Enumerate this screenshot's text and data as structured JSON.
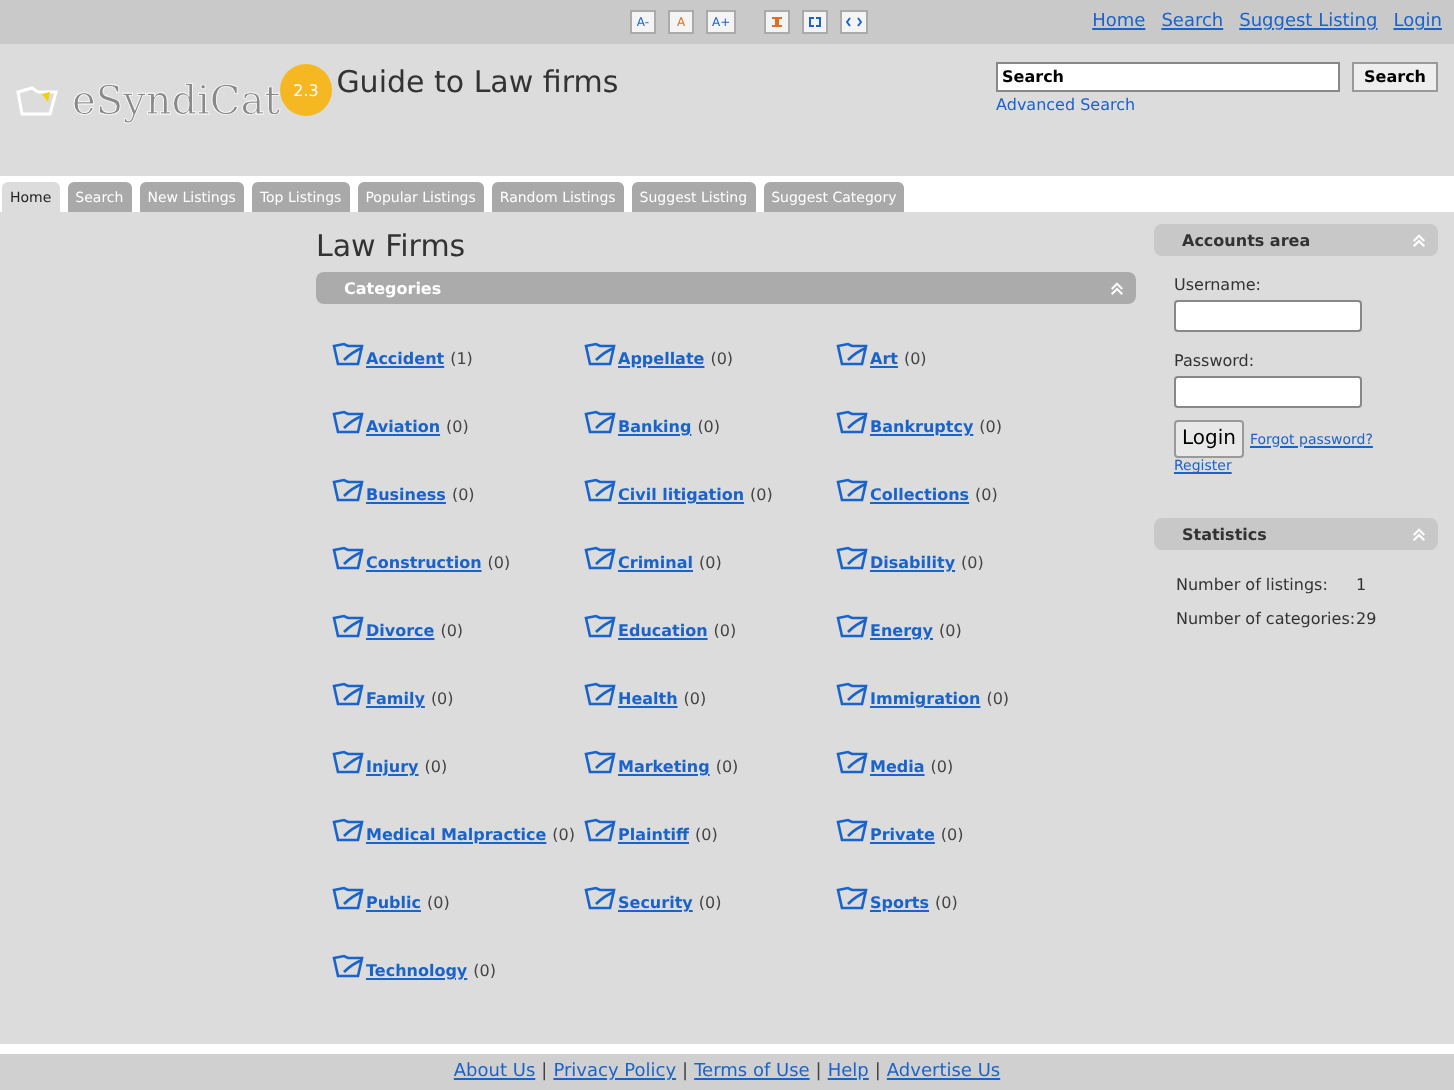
{
  "font_tools": [
    "A-",
    "A",
    "A+"
  ],
  "top_links": [
    "Home",
    "Search",
    "Suggest Listing",
    "Login"
  ],
  "logo": {
    "text": "eSyndiCat",
    "badge": "2.3"
  },
  "site_title": "Guide to Law firms",
  "search": {
    "value": "Search",
    "button": "Search",
    "advanced": "Advanced Search"
  },
  "tabs": [
    {
      "label": "Home",
      "selected": true
    },
    {
      "label": "Search",
      "selected": false
    },
    {
      "label": "New Listings",
      "selected": false
    },
    {
      "label": "Top Listings",
      "selected": false
    },
    {
      "label": "Popular Listings",
      "selected": false
    },
    {
      "label": "Random Listings",
      "selected": false
    },
    {
      "label": "Suggest Listing",
      "selected": false
    },
    {
      "label": "Suggest Category",
      "selected": false
    }
  ],
  "page_title": "Law Firms",
  "categories_header": "Categories",
  "categories": [
    {
      "name": "Accident",
      "count": "(1)"
    },
    {
      "name": "Appellate",
      "count": "(0)"
    },
    {
      "name": "Art",
      "count": "(0)"
    },
    {
      "name": "Aviation",
      "count": "(0)"
    },
    {
      "name": "Banking",
      "count": "(0)"
    },
    {
      "name": "Bankruptcy",
      "count": "(0)"
    },
    {
      "name": "Business",
      "count": "(0)"
    },
    {
      "name": "Civil litigation",
      "count": "(0)"
    },
    {
      "name": "Collections",
      "count": "(0)"
    },
    {
      "name": "Construction",
      "count": "(0)"
    },
    {
      "name": "Criminal",
      "count": "(0)"
    },
    {
      "name": "Disability",
      "count": "(0)"
    },
    {
      "name": "Divorce",
      "count": "(0)"
    },
    {
      "name": "Education",
      "count": "(0)"
    },
    {
      "name": "Energy",
      "count": "(0)"
    },
    {
      "name": "Family",
      "count": "(0)"
    },
    {
      "name": "Health",
      "count": "(0)"
    },
    {
      "name": "Immigration",
      "count": "(0)"
    },
    {
      "name": "Injury",
      "count": "(0)"
    },
    {
      "name": "Marketing",
      "count": "(0)"
    },
    {
      "name": "Media",
      "count": "(0)"
    },
    {
      "name": "Medical Malpractice",
      "count": "(0)"
    },
    {
      "name": "Plaintiff",
      "count": "(0)"
    },
    {
      "name": "Private",
      "count": "(0)"
    },
    {
      "name": "Public",
      "count": "(0)"
    },
    {
      "name": "Security",
      "count": "(0)"
    },
    {
      "name": "Sports",
      "count": "(0)"
    },
    {
      "name": "Technology",
      "count": "(0)"
    }
  ],
  "accounts": {
    "title": "Accounts area",
    "username_label": "Username:",
    "password_label": "Password:",
    "login": "Login",
    "forgot": "Forgot password?",
    "register": "Register"
  },
  "statistics": {
    "title": "Statistics",
    "rows": [
      {
        "label": "Number of listings:",
        "value": "1"
      },
      {
        "label": "Number of categories:",
        "value": "29"
      }
    ]
  },
  "footer_links": [
    "About Us",
    "Privacy Policy",
    "Terms of Use",
    "Help",
    "Advertise Us"
  ],
  "footer_separator": "|"
}
